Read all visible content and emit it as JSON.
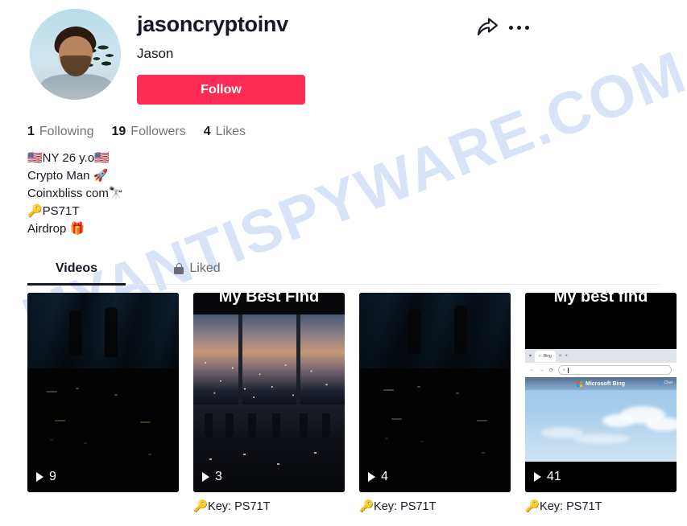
{
  "watermark": {
    "text": "MYANTISPYWARE.COM"
  },
  "header": {
    "username": "jasoncryptoinv",
    "nickname": "Jason",
    "follow_label": "Follow",
    "share_icon": "share-arrow-icon",
    "more_icon": "more-options-icon",
    "avatar_alt": "profile-photo"
  },
  "stats": [
    {
      "num": "1",
      "label": "Following"
    },
    {
      "num": "19",
      "label": "Followers"
    },
    {
      "num": "4",
      "label": "Likes"
    }
  ],
  "bio": {
    "lines": [
      "🇺🇸NY 26 y.o🇺🇸",
      "Crypto Man 🚀",
      "Coinxbliss com🔭",
      "🔑PS71T",
      "Airdrop 🎁"
    ]
  },
  "tabs": [
    {
      "label": "Videos",
      "active": true,
      "icon": ""
    },
    {
      "label": "Liked",
      "active": false,
      "icon": "lock-icon"
    }
  ],
  "videos": [
    {
      "plays": "9",
      "overlay_title": "",
      "caption": ""
    },
    {
      "plays": "3",
      "overlay_title": "My Best Find",
      "caption": "🔑Key: PS71T"
    },
    {
      "plays": "4",
      "overlay_title": "",
      "caption": "🔑Key: PS71T"
    },
    {
      "plays": "41",
      "overlay_title": "My best find",
      "caption": "🔑Key: PS71T"
    }
  ],
  "browser_thumb": {
    "tab_title": "Bing",
    "tab_close": "×",
    "tab_new": "+",
    "back": "←",
    "forward": "→",
    "reload": "⟳",
    "search_glyph": "⌕",
    "bing_text": "Microsoft Bing",
    "chat_label": "Chat"
  },
  "colors": {
    "accent": "#FE2C55",
    "text": "#161823",
    "muted": "#757575",
    "watermark": "#B9CDF2"
  }
}
